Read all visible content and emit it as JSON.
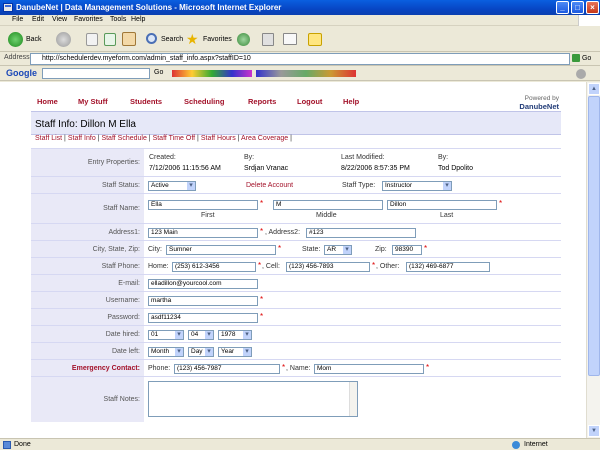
{
  "window": {
    "title": "DanubeNet | Data Management Solutions - Microsoft Internet Explorer"
  },
  "menu": [
    "File",
    "Edit",
    "View",
    "Favorites",
    "Tools",
    "Help"
  ],
  "toolbar": {
    "back": "Back",
    "search": "Search",
    "favorites": "Favorites"
  },
  "address": {
    "label": "Address",
    "url": "http://schedulerdev.myeform.com/admin_staff_info.aspx?staffID=10",
    "go": "Go"
  },
  "googlebar": {
    "logo": "Google",
    "go": "Go"
  },
  "nav": [
    "Home",
    "My Stuff",
    "Students",
    "Scheduling",
    "Reports",
    "Logout",
    "Help"
  ],
  "powered": {
    "line1": "Powered by",
    "brand": "DanubeNet"
  },
  "page_title": "Staff Info: Dillon M Ella",
  "subnav": [
    "Staff List",
    "Staff Info",
    "Staff Schedule",
    "Staff Time Off",
    "Staff Hours",
    "Area Coverage"
  ],
  "form": {
    "entry": {
      "label": "Entry Properties:",
      "created_h": "Created:",
      "created": "7/12/2006 11:15:56 AM",
      "by1_h": "By:",
      "by1": "Srdjan Vranac",
      "modified_h": "Last Modified:",
      "modified": "8/22/2006 8:57:35 PM",
      "by2_h": "By:",
      "by2": "Tod Dpolito"
    },
    "status": {
      "label": "Staff Status:",
      "value": "Active",
      "delete": "Delete Account",
      "type_label": "Staff Type:",
      "type": "Instructor"
    },
    "name": {
      "label": "Staff Name:",
      "first": "Ella",
      "middle": "M",
      "last": "Dillon",
      "first_cap": "First",
      "middle_cap": "Middle",
      "last_cap": "Last"
    },
    "address": {
      "label": "Address1:",
      "value": "123 Main",
      "label2": ", Address2:",
      "value2": "#123"
    },
    "city": {
      "label": "City, State, Zip:",
      "city_l": "City:",
      "city": "Sumner",
      "state_l": "State:",
      "state": "AR",
      "zip_l": "Zip:",
      "zip": "98390"
    },
    "phone": {
      "label": "Staff Phone:",
      "home_l": "Home:",
      "home": "(253) 612-3456",
      "cell_l": ", Cell:",
      "cell": "(123) 456-7893",
      "other_l": ", Other:",
      "other": "(132) 469-6877"
    },
    "email": {
      "label": "E-mail:",
      "value": "elladillon@yourcool.com"
    },
    "username": {
      "label": "Username:",
      "value": "martha"
    },
    "password": {
      "label": "Password:",
      "value": "asdf11234"
    },
    "hired": {
      "label": "Date hired:",
      "month": "01",
      "day": "04",
      "year": "1978"
    },
    "left": {
      "label": "Date left:",
      "month": "Month",
      "day": "Day",
      "year": "Year"
    },
    "emergency": {
      "label": "Emergency Contact:",
      "phone_l": "Phone:",
      "phone": "(123) 456-7987",
      "name_l": ", Name:",
      "name": "Mom"
    },
    "notes": {
      "label": "Staff Notes:"
    }
  },
  "status": {
    "text": "Done",
    "zone": "Internet"
  },
  "colors": {
    "nav_red": "#A3122A",
    "title_blue": "#0746C4"
  }
}
